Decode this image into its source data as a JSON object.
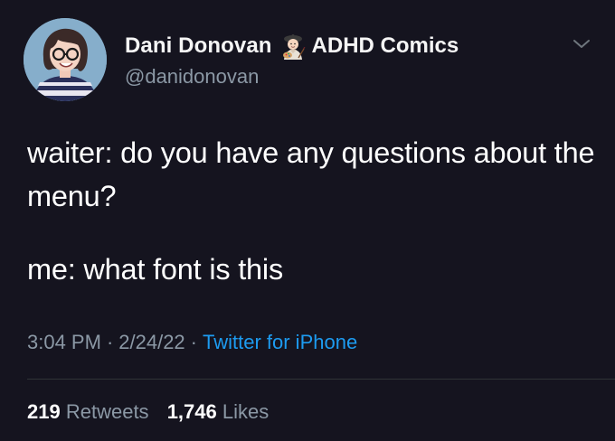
{
  "tweet": {
    "author": {
      "display_name": "Dani Donovan",
      "name_emoji": "artist-emoji",
      "display_name_suffix": "ADHD Comics",
      "handle": "@danidonovan",
      "avatar_icon": "avatar-illustration"
    },
    "menu_icon": "chevron-down-icon",
    "text_paragraphs": [
      "waiter: do you have any questions about the menu?",
      "me: what font is this"
    ],
    "time": "3:04 PM",
    "date": "2/24/22",
    "separator": "·",
    "source": "Twitter for iPhone",
    "stats": {
      "retweets_count": "219",
      "retweets_label": "Retweets",
      "likes_count": "1,746",
      "likes_label": "Likes"
    }
  },
  "colors": {
    "background": "#15141f",
    "text_primary": "#ffffff",
    "text_secondary": "#8b98a5",
    "link": "#1d9bf0",
    "divider": "#2f3336"
  }
}
